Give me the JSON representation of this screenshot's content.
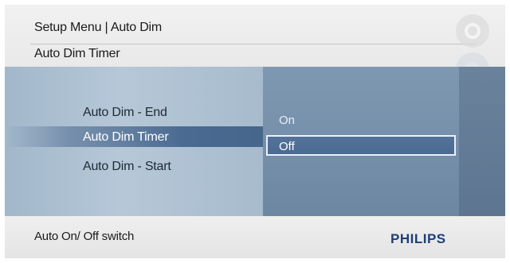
{
  "header": {
    "breadcrumb": "Setup Menu | Auto Dim",
    "title": "Auto Dim Timer"
  },
  "left_menu": {
    "items": [
      {
        "label": "Auto Dim - End",
        "selected": false
      },
      {
        "label": "Auto Dim Timer",
        "selected": true
      },
      {
        "label": "Auto Dim - Start",
        "selected": false
      }
    ]
  },
  "options": {
    "items": [
      {
        "label": "On",
        "selected": false
      },
      {
        "label": "Off",
        "selected": true
      }
    ]
  },
  "footer": {
    "hint": "Auto On/ Off switch",
    "brand": "PHILIPS"
  },
  "colors": {
    "brand": "#1d3f7a",
    "highlight": "#4a6a91",
    "panel": "#a9bdcf"
  },
  "icons": [
    "settings-watermark-icon",
    "nav-pad-watermark-icon",
    "menu-watermark-icon"
  ]
}
